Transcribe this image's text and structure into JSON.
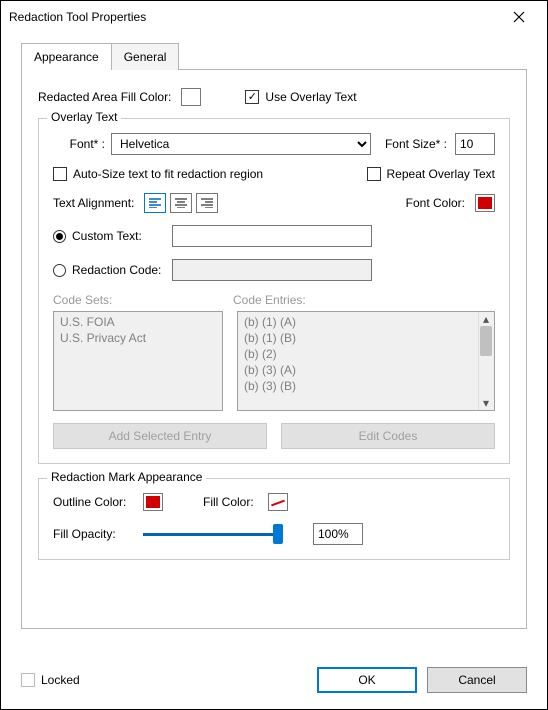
{
  "title": "Redaction Tool Properties",
  "tabs": {
    "appearance": "Appearance",
    "general": "General"
  },
  "fill_color_label": "Redacted Area Fill Color:",
  "fill_color": "#000000",
  "use_overlay_label": "Use Overlay Text",
  "overlay": {
    "legend": "Overlay Text",
    "font_label": "Font* :",
    "font_value": "Helvetica",
    "font_size_label": "Font Size* :",
    "font_size_value": "10",
    "autosize_label": "Auto-Size text to fit redaction region",
    "repeat_label": "Repeat Overlay Text",
    "align_label": "Text Alignment:",
    "font_color_label": "Font Color:",
    "font_color": "#d00000",
    "custom_text_label": "Custom Text:",
    "redaction_code_label": "Redaction Code:",
    "code_sets_label": "Code Sets:",
    "code_entries_label": "Code Entries:",
    "code_sets": [
      "U.S. FOIA",
      "U.S. Privacy Act"
    ],
    "code_entries": [
      "(b) (1) (A)",
      "(b) (1) (B)",
      "(b) (2)",
      "(b) (3) (A)",
      "(b) (3) (B)"
    ],
    "add_entry_btn": "Add Selected Entry",
    "edit_codes_btn": "Edit Codes"
  },
  "mark": {
    "legend": "Redaction Mark Appearance",
    "outline_label": "Outline Color:",
    "outline_color": "#d00000",
    "fill_label": "Fill Color:",
    "opacity_label": "Fill Opacity:",
    "opacity_value": "100%"
  },
  "locked_label": "Locked",
  "ok": "OK",
  "cancel": "Cancel"
}
